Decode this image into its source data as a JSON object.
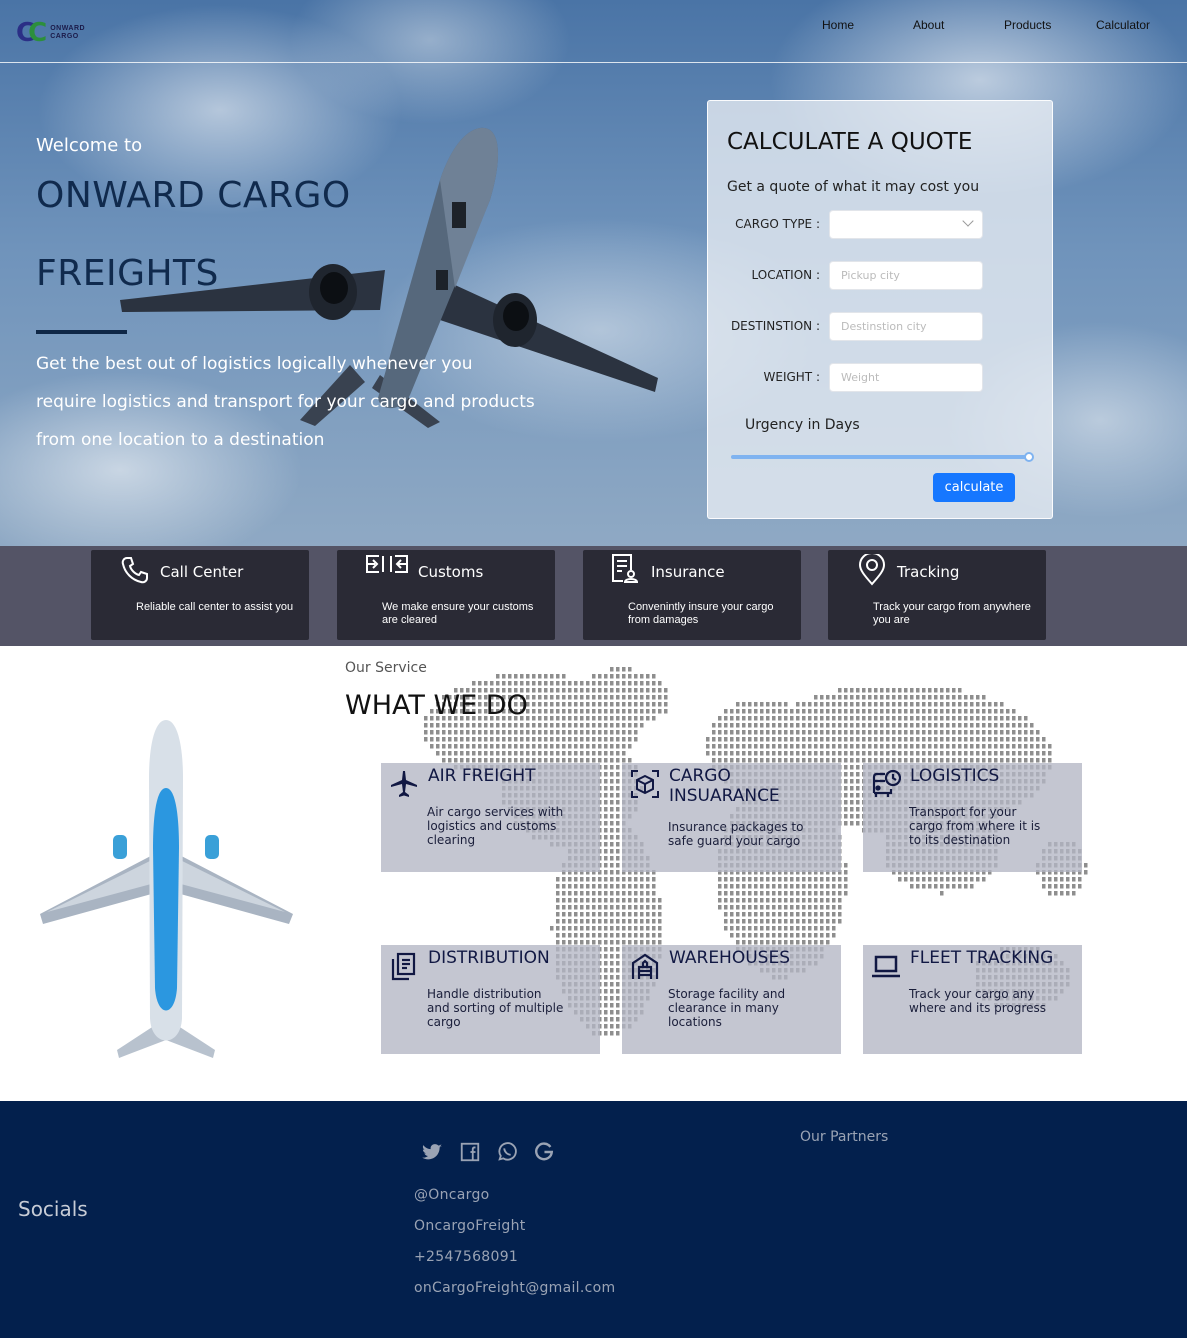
{
  "brand": {
    "logo_mark": "CC",
    "logo_line1": "ONWARD",
    "logo_line2": "CARGO"
  },
  "nav": {
    "items": [
      "Home",
      "About",
      "Products",
      "Calculator"
    ]
  },
  "hero": {
    "welcome": "Welcome to",
    "title_line1": "ONWARD CARGO",
    "title_line2": "FREIGHTS",
    "description_line1": "Get the best out of logistics logically whenever you",
    "description_line2": "require logistics and transport for your cargo and products",
    "description_line3": "from one location to a destination"
  },
  "quote": {
    "title": "CALCULATE A QUOTE",
    "subtitle": "Get a quote of what it may cost you",
    "cargo_type_label": "CARGO TYPE",
    "location_label": "LOCATION",
    "location_placeholder": "Pickup city",
    "destination_label": "DESTINSTION",
    "destination_placeholder": "Destinstion city",
    "weight_label": "WEIGHT",
    "weight_placeholder": "Weight",
    "urgency_label": "Urgency in Days",
    "urgency_value_fraction": 1.0,
    "button": "calculate",
    "accent_color": "#1677ff"
  },
  "features": [
    {
      "icon": "phone-icon",
      "title": "Call Center",
      "desc": "Reliable call center to assist you"
    },
    {
      "icon": "customs-icon",
      "title": "Customs",
      "desc": "We make ensure your customs are cleared"
    },
    {
      "icon": "insurance-icon",
      "title": "Insurance",
      "desc": "Convenintly insure your cargo from damages"
    },
    {
      "icon": "location-pin-icon",
      "title": "Tracking",
      "desc": "Track your cargo from anywhere you are"
    }
  ],
  "services": {
    "eyebrow": "Our Service",
    "title": "WHAT WE DO",
    "cards": [
      {
        "icon": "airplane-icon",
        "title": "AIR FREIGHT",
        "desc": "Air cargo services with logistics and customs clearing"
      },
      {
        "icon": "cube-icon",
        "title": "CARGO INSUARANCE",
        "desc": "Insurance packages to safe guard your cargo"
      },
      {
        "icon": "bus-clock-icon",
        "title": "LOGISTICS",
        "desc": "Transport for your cargo from where it is to its destination"
      },
      {
        "icon": "documents-icon",
        "title": "DISTRIBUTION",
        "desc": "Handle distribution and sorting of multiple cargo"
      },
      {
        "icon": "warehouse-icon",
        "title": "WAREHOUSES",
        "desc": "Storage facility and clearance in many locations"
      },
      {
        "icon": "laptop-icon",
        "title": "FLEET TRACKING",
        "desc": "Track your cargo any where and its progress"
      }
    ]
  },
  "footer": {
    "socials": "Socials",
    "social_icons": [
      "twitter-icon",
      "facebook-icon",
      "whatsapp-icon",
      "google-icon"
    ],
    "handle": "@Oncargo",
    "page": "OncargoFreight",
    "phone": "+2547568091",
    "email": "onCargoFreight@gmail.com",
    "partners": "Our Partners"
  }
}
